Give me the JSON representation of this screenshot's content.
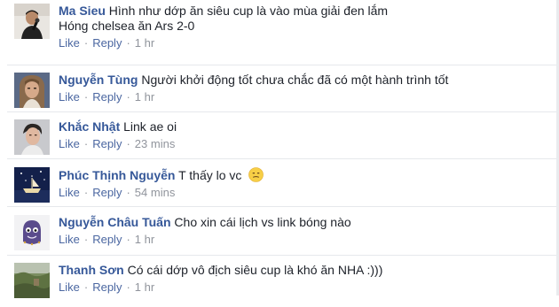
{
  "actions": {
    "like_label": "Like",
    "reply_label": "Reply",
    "separator": "·"
  },
  "comments": [
    {
      "author": "Ma Sieu",
      "text": "Hình như dớp ăn siêu cup là vào mùa giải đen lắm",
      "text_line2": "Hóng chelsea ăn Ars 2-0",
      "time": "1 hr",
      "avatar": "man-with-microphone-photo"
    },
    {
      "author": "Nguyễn Tùng",
      "text": "Người khởi động tốt chưa chắc đã có một hành trình tốt",
      "time": "1 hr",
      "avatar": "long-haired-man-photo"
    },
    {
      "author": "Khắc Nhật",
      "text": "Link ae oi",
      "time": "23 mins",
      "avatar": "young-man-portrait-photo"
    },
    {
      "author": "Phúc Thịnh Nguyễn",
      "text": "T thấy lo vc",
      "time": "54 mins",
      "avatar": "night-boat-scene-photo",
      "emoji": "confused-face-emoji"
    },
    {
      "author": "Nguyễn Châu Tuấn",
      "text": "Cho xin cái lịch vs link bóng nào",
      "time": "1 hr",
      "avatar": "cartoon-character-avatar"
    },
    {
      "author": "Thanh Sơn",
      "text": "Có cái dớp vô địch siêu cup là khó ăn NHA :)))",
      "time": "1 hr",
      "avatar": "outdoor-landscape-photo"
    }
  ],
  "colors": {
    "author_link": "#365899",
    "action_link": "#4b67a1",
    "meta_gray": "#90949c",
    "body_text": "#1d2129",
    "divider": "#e6e8ec"
  }
}
